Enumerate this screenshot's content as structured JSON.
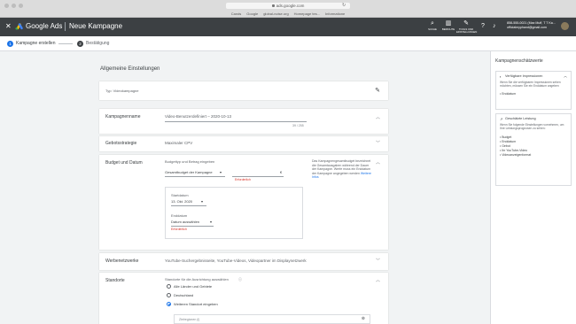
{
  "browser": {
    "url": "ads.google.com",
    "bookmarks": [
      "Cands",
      "Google",
      "global-noise.org",
      "Homepage tes...",
      "Informatione"
    ]
  },
  "header": {
    "close_icon": "close-icon",
    "brand": "Google Ads",
    "title": "Neue Kampagne",
    "tools": [
      {
        "icon": "search-icon",
        "label": "SUCHE"
      },
      {
        "icon": "report-icon",
        "label": "BERICHTE"
      },
      {
        "icon": "tools-icon",
        "label": "TOOLS UND EINSTELLUNGEN"
      }
    ],
    "account_line1": "858-555-0021 (Max Muff, T T Ka...",
    "account_line2": "officialmyphand@gmail.com"
  },
  "stepper": {
    "step1_number": "1",
    "step1_label": "Kampagne erstellen",
    "step2_number": "2",
    "step2_label": "Bestätigung"
  },
  "main": {
    "section_title": "Allgemeine Einstellungen",
    "type_label": "Typ: Videokampagne",
    "campaign_name_label": "Kampagnenname",
    "campaign_name_value": "Video-Benutzerdefiniert – 2020-10-13",
    "campaign_name_counter": "39 / 255",
    "bidding_label": "Gebotsstrategie",
    "bidding_value": "Maximaler CPV",
    "budget_label": "Budget und Datum",
    "budget_hint": "Budgettyp und Betrag eingeben",
    "budget_type_value": "Gesamtbudget der Kampagne",
    "budget_currency": "€",
    "budget_required": "Erforderlich",
    "budget_info": "Das Kampagnengesamtbudget bezeichnet die Gesamtausgaben während der Dauer der Kampagne. Werfe muss ein Enddatum der Kampagne angegeben werden",
    "budget_info_link": "Weitere Infos",
    "start_label": "Startdatum",
    "start_value": "13. Okt. 2020",
    "end_label": "Enddatum",
    "end_value": "Datum auswählen",
    "end_required": "Erforderlich",
    "networks_label": "Werbenetzwerke",
    "networks_value": "YouTube-Suchergebnisseite, YouTube-Videos, Videopartner im Displaynetzwerk",
    "locations_label": "Standorte",
    "locations_hint": "Standorte für die Ausrichtung auswählen",
    "location_options": [
      "Alle Länder und Gebiete",
      "Deutschland",
      "Weiteren Standort eingeben"
    ],
    "search_placeholder": "Zielregionen (i)"
  },
  "side": {
    "title": "Kampagnenschätzwerte",
    "impressions_title": "Verfügbare Impressionen",
    "impressions_body": "Wenn Sie die verfügbaren Impressionen sehen möchten, müssen Sie ein Enddatum angeben",
    "impressions_bullet": "Enddatum",
    "performance_title": "Geschätzte Leistung",
    "performance_body": "Wenn Sie folgende Einstellungen vornehmen, um Ihre Leistungsprognosen zu sehen:",
    "performance_bullets": [
      "Budget",
      "Enddatum",
      "Gebot",
      "Ihr YouTube-Video",
      "Videoanzeigenformat"
    ]
  },
  "colors": {
    "header_bg": "#3c4043",
    "accent": "#1a73e8",
    "error": "#d93025"
  }
}
